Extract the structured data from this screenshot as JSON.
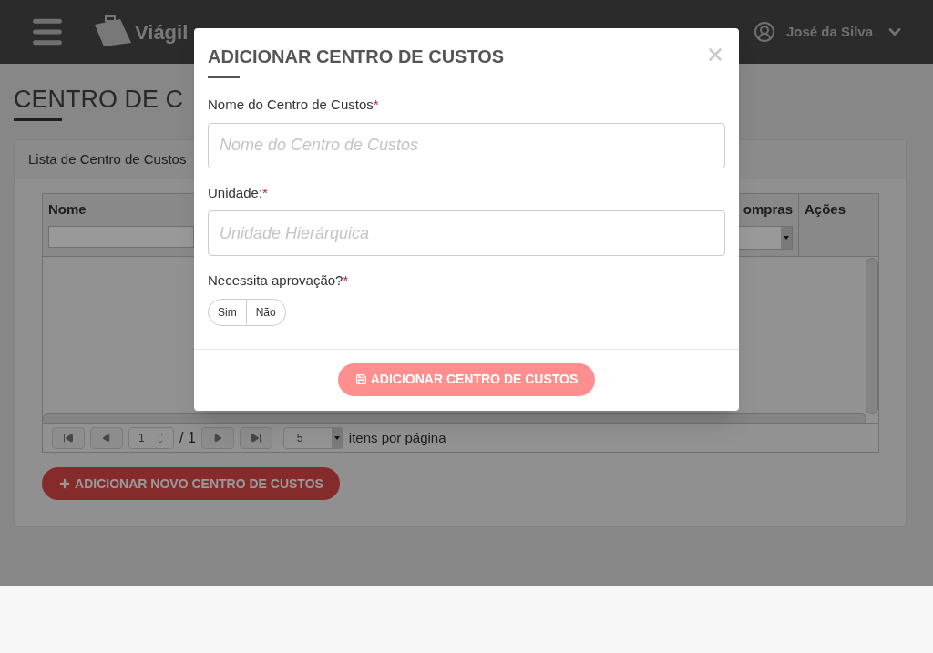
{
  "header": {
    "logo_text": "Viágil",
    "user_name": "José da Silva"
  },
  "page": {
    "title": "CENTRO DE C",
    "panel_title": "Lista de Centro de Custos",
    "table": {
      "columns": [
        {
          "label": "Nome",
          "kind": "input"
        },
        {
          "label": "ompras",
          "kind": "select"
        },
        {
          "label": "Ações",
          "kind": "plain"
        }
      ]
    },
    "pager": {
      "page": "1",
      "total": "/ 1",
      "page_size": "5",
      "per_page_label": "itens por página"
    },
    "add_button": {
      "label": "ADICIONAR NOVO CENTRO DE CUSTOS"
    }
  },
  "modal": {
    "title": "ADICIONAR CENTRO DE CUSTOS",
    "fields": [
      {
        "label": "Nome do Centro de Custos",
        "required_mark": "*",
        "placeholder": "Nome do Centro de Custos"
      },
      {
        "label": "Unidade:",
        "required_mark": "*",
        "placeholder": "Unidade Hierárquica"
      }
    ],
    "toggle": {
      "label": "Necessita aprovação?",
      "required_mark": "*",
      "options": [
        {
          "label": "Sim",
          "selected": false
        },
        {
          "label": "Não",
          "selected": false
        }
      ]
    },
    "submit": {
      "label": "ADICIONAR CENTRO DE CUSTOS",
      "disabled": true
    }
  }
}
